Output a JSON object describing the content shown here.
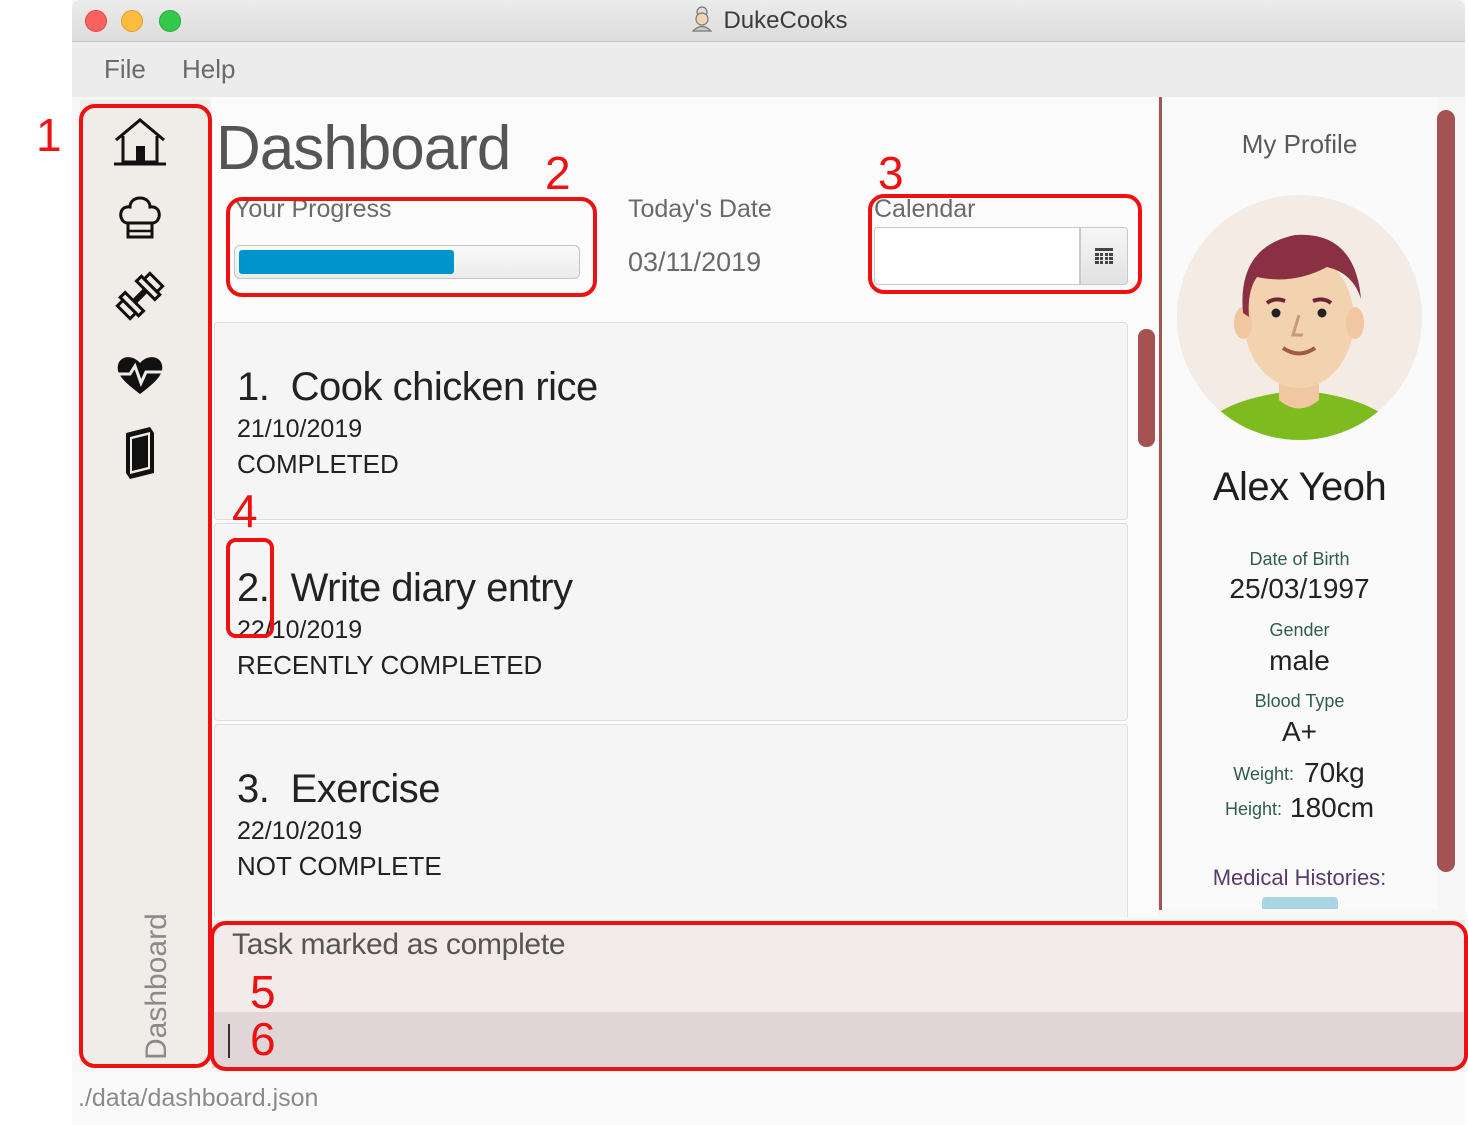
{
  "window": {
    "title": "DukeCooks",
    "title_icon": "chef-icon"
  },
  "menu": {
    "items": [
      "File",
      "Help"
    ]
  },
  "sidebar": {
    "buttons": [
      {
        "icon": "home-icon"
      },
      {
        "icon": "chef-hat-icon"
      },
      {
        "icon": "dumbbell-icon"
      },
      {
        "icon": "heartbeat-icon"
      },
      {
        "icon": "book-icon"
      }
    ],
    "current_label": "Dashboard"
  },
  "dashboard": {
    "title": "Dashboard",
    "progress_label": "Your Progress",
    "progress_fraction": 0.64,
    "date_label": "Today's Date",
    "date_value": "03/11/2019",
    "calendar_label": "Calendar",
    "calendar_value": "",
    "calendar_icon": "calendar-icon"
  },
  "tasks": [
    {
      "index": "1.",
      "name": "Cook chicken rice",
      "date": "21/10/2019",
      "status": "COMPLETED"
    },
    {
      "index": "2.",
      "name": "Write diary entry",
      "date": "22/10/2019",
      "status": "RECENTLY COMPLETED"
    },
    {
      "index": "3.",
      "name": "Exercise",
      "date": "22/10/2019",
      "status": "NOT COMPLETE"
    }
  ],
  "profile": {
    "heading": "My Profile",
    "avatar_icon": "user-avatar-icon",
    "name": "Alex Yeoh",
    "dob_label": "Date of Birth",
    "dob": "25/03/1997",
    "gender_label": "Gender",
    "gender": "male",
    "blood_label": "Blood Type",
    "blood": "A+",
    "weight_label": "Weight:",
    "weight": "70kg",
    "height_label": "Height:",
    "height": "180cm",
    "medical_label": "Medical Histories:"
  },
  "result": {
    "message": "Task marked as complete"
  },
  "command": {
    "value": ""
  },
  "status": {
    "path": "./data/dashboard.json"
  },
  "annotations": [
    "1",
    "2",
    "3",
    "4",
    "5",
    "6"
  ],
  "colors": {
    "accent": "#a55252",
    "progress": "#0094cc",
    "annotation": "#ee1111"
  }
}
